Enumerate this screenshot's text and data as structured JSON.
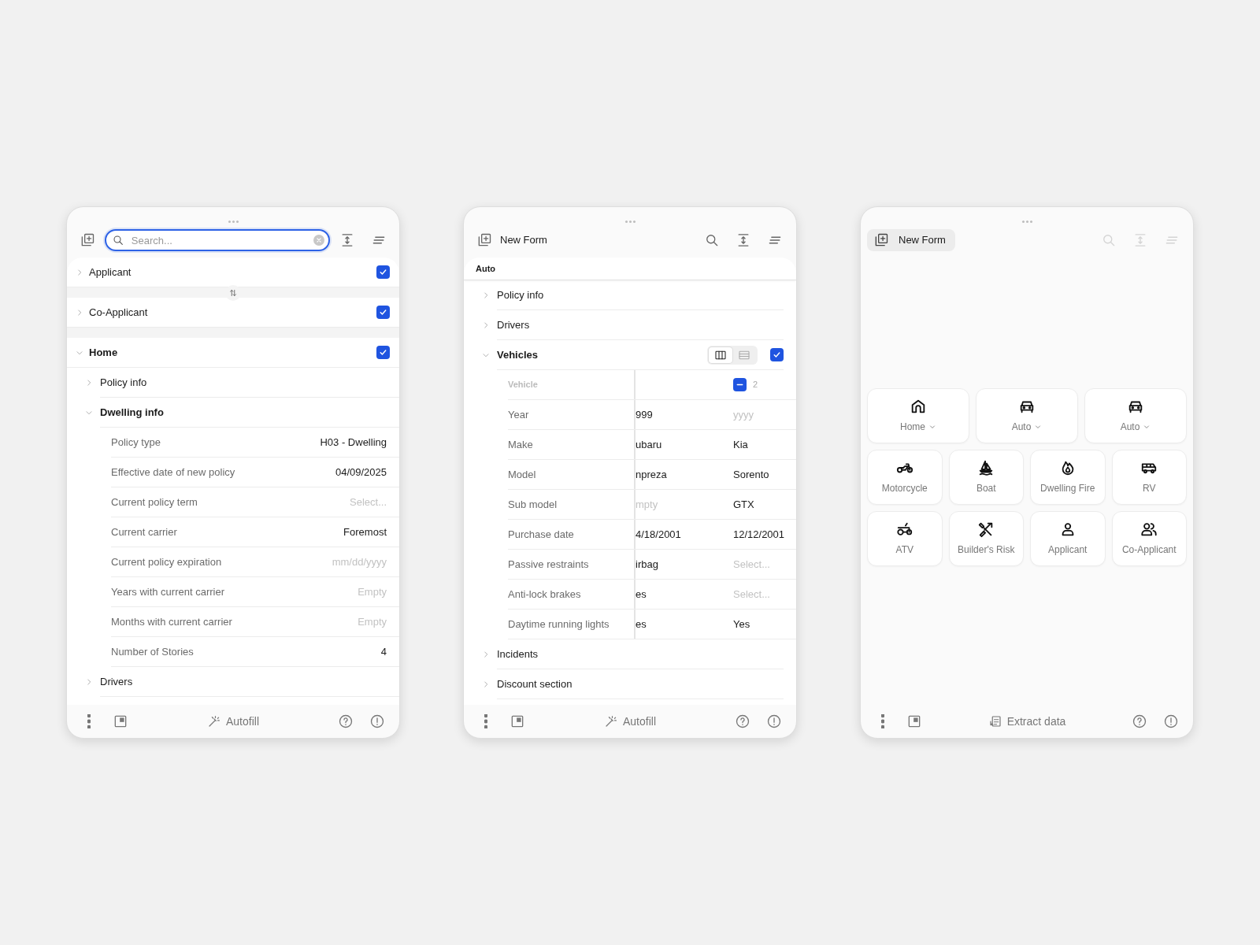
{
  "left_panel": {
    "search": {
      "placeholder": "Search...",
      "focused": true
    },
    "sections": [
      {
        "label": "Applicant",
        "expanded": false,
        "checked": true
      },
      {
        "label": "Co-Applicant",
        "expanded": false,
        "checked": true
      },
      {
        "label": "Home",
        "expanded": true,
        "checked": true,
        "children": [
          {
            "label": "Policy info",
            "expanded": false
          },
          {
            "label": "Dwelling info",
            "expanded": true,
            "fields": [
              {
                "label": "Policy type",
                "value": "H03 - Dwelling"
              },
              {
                "label": "Effective date of new policy",
                "value": "04/09/2025"
              },
              {
                "label": "Current policy term",
                "placeholder": "Select..."
              },
              {
                "label": "Current carrier",
                "value": "Foremost"
              },
              {
                "label": "Current policy expiration",
                "placeholder": "mm/dd/yyyy"
              },
              {
                "label": "Years with current carrier",
                "placeholder": "Empty"
              },
              {
                "label": "Months with current carrier",
                "placeholder": "Empty"
              },
              {
                "label": "Number of Stories",
                "value": "4"
              }
            ]
          },
          {
            "label": "Drivers",
            "expanded": false
          }
        ]
      }
    ],
    "footer": {
      "action": {
        "kind": "autofill",
        "label": "Autofill"
      }
    }
  },
  "middle_panel": {
    "title": "New Form",
    "group_label": "Auto",
    "items": [
      {
        "label": "Policy info",
        "expanded": false
      },
      {
        "label": "Drivers",
        "expanded": false
      },
      {
        "label": "Vehicles",
        "expanded": true,
        "checked": true,
        "view_toggle": [
          {
            "kind": "columns",
            "selected": true
          },
          {
            "kind": "rows",
            "selected": false
          }
        ],
        "table": {
          "header": "Vehicle",
          "column_2_header": {
            "label": "2",
            "indeterminate": true
          },
          "rows": [
            {
              "label": "Year",
              "cells": [
                {
                  "value": "999"
                },
                {
                  "placeholder": "yyyy"
                }
              ]
            },
            {
              "label": "Make",
              "cells": [
                {
                  "value": "ubaru"
                },
                {
                  "value": "Kia"
                }
              ]
            },
            {
              "label": "Model",
              "cells": [
                {
                  "value": "npreza"
                },
                {
                  "value": "Sorento"
                }
              ]
            },
            {
              "label": "Sub model",
              "cells": [
                {
                  "placeholder": "mpty"
                },
                {
                  "value": "GTX"
                }
              ]
            },
            {
              "label": "Purchase date",
              "cells": [
                {
                  "value": "4/18/2001"
                },
                {
                  "value": "12/12/2001"
                }
              ]
            },
            {
              "label": "Passive restraints",
              "cells": [
                {
                  "value": "irbag"
                },
                {
                  "placeholder": "Select..."
                }
              ]
            },
            {
              "label": "Anti-lock brakes",
              "cells": [
                {
                  "value": "es"
                },
                {
                  "placeholder": "Select..."
                }
              ]
            },
            {
              "label": "Daytime running lights",
              "cells": [
                {
                  "value": "es"
                },
                {
                  "value": "Yes"
                }
              ]
            }
          ]
        }
      },
      {
        "label": "Incidents",
        "expanded": false
      },
      {
        "label": "Discount section",
        "expanded": false
      }
    ],
    "footer": {
      "action": {
        "kind": "autofill",
        "label": "Autofill"
      }
    }
  },
  "right_panel": {
    "new_form": {
      "label": "New Form",
      "selected": true
    },
    "toolbar_disabled": true,
    "tiles": [
      {
        "kind": "home",
        "label": "Home",
        "dropdown": true
      },
      {
        "kind": "car",
        "label": "Auto",
        "dropdown": true
      },
      {
        "kind": "car",
        "label": "Auto",
        "dropdown": true
      },
      {
        "kind": "motorcycle",
        "label": "Motorcycle",
        "dropdown": false
      },
      {
        "kind": "boat",
        "label": "Boat",
        "dropdown": false
      },
      {
        "kind": "fire",
        "label": "Dwelling Fire",
        "dropdown": false
      },
      {
        "kind": "rv",
        "label": "RV",
        "dropdown": false
      },
      {
        "kind": "atv",
        "label": "ATV",
        "dropdown": false
      },
      {
        "kind": "tools",
        "label": "Builder's Risk",
        "dropdown": false
      },
      {
        "kind": "person",
        "label": "Applicant",
        "dropdown": false
      },
      {
        "kind": "people",
        "label": "Co-Applicant",
        "dropdown": false
      }
    ],
    "footer": {
      "action": {
        "kind": "extract",
        "label": "Extract data"
      }
    }
  }
}
